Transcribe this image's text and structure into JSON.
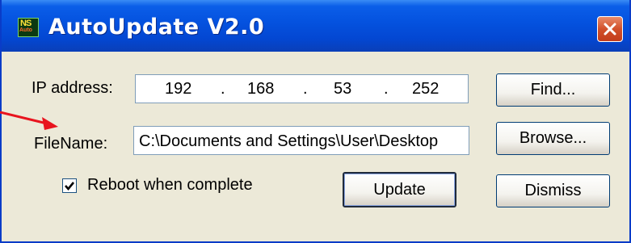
{
  "window": {
    "title": "AutoUpdate V2.0",
    "app_icon_text": "NS",
    "app_icon_subtext": "Auto"
  },
  "ip": {
    "label": "IP address:",
    "octets": [
      "192",
      "168",
      "53",
      "252"
    ],
    "dot": "."
  },
  "file": {
    "label": "FileName:",
    "value": "C:\\Documents and Settings\\User\\Desktop"
  },
  "checkbox": {
    "label": "Reboot when complete",
    "checked": true
  },
  "buttons": {
    "find": "Find...",
    "browse": "Browse...",
    "update": "Update",
    "dismiss": "Dismiss"
  },
  "colors": {
    "titlebar": "#0553e0",
    "annotation_arrow": "#e8141e",
    "dialog_face": "#ece9d8"
  },
  "annotation": {
    "arrow_icon": "red-arrow-icon"
  }
}
